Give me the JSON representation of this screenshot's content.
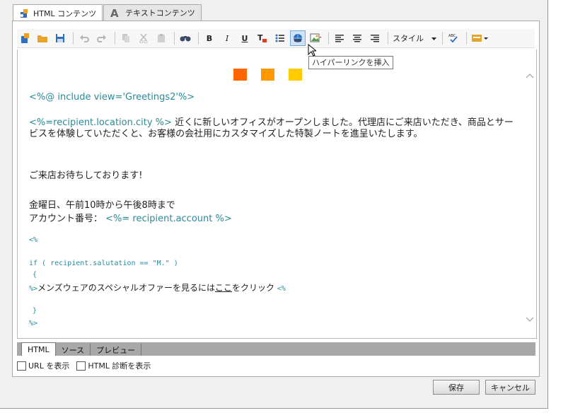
{
  "tabs": [
    {
      "label": "HTML コンテンツ",
      "icon": "html-content-icon"
    },
    {
      "label": "テキストコンテンツ",
      "icon": "text-content-icon"
    }
  ],
  "toolbar": {
    "style_label": "スタイル",
    "tooltip": "ハイパーリンクを挿入",
    "bold": "B",
    "italic": "I",
    "underline": "U"
  },
  "editor": {
    "include_line": "<%@ include view='Greetings2'%>",
    "city_var": "<%=recipient.location.city %>",
    "para1_text": "近くに新しいオフィスがオープンしました。代理店にご来店いただき、商品とサービスを体験していただくと、お客様の会社用にカスタマイズした特製ノートを進呈いたします。",
    "para2": "ご来店お待ちしております!",
    "hours": "金曜日、午前10時から午後8時まで",
    "account_label": "アカウント番号：",
    "account_var": "<%= recipient.account %>",
    "code_open": "<%",
    "code_if": "if ( recipient.salutation == \"M.\" )",
    "code_brace_open": "{",
    "code_close_prefix": "%>",
    "offer_text": "メンズウェアのスペシャルオファーを見るには",
    "offer_link": "ここ",
    "offer_suffix": "をクリック",
    "code_open2": "<%",
    "code_brace_close": "}",
    "code_end": "%>",
    "squares": [
      "#ff6600",
      "#ff9900",
      "#ffcc00"
    ]
  },
  "bottom_tabs": [
    "HTML",
    "ソース",
    "プレビュー"
  ],
  "checks": [
    {
      "label": "URL を表示",
      "checked": false
    },
    {
      "label": "HTML 診断を表示",
      "checked": false
    }
  ],
  "buttons": {
    "save": "保存",
    "cancel": "キャンセル"
  }
}
